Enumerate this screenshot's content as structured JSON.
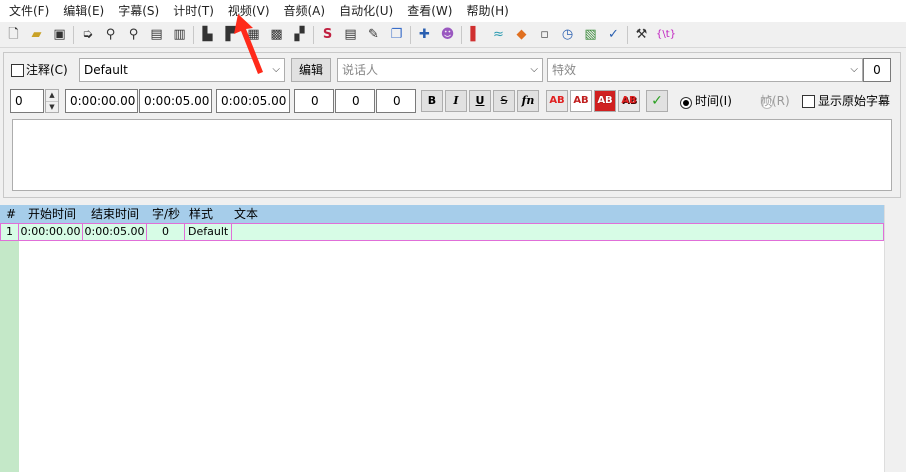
{
  "menu": [
    "文件(F)",
    "编辑(E)",
    "字幕(S)",
    "计时(T)",
    "视频(V)",
    "音频(A)",
    "自动化(U)",
    "查看(W)",
    "帮助(H)"
  ],
  "toolbar": {
    "groups": [
      [
        "new-file-icon",
        "open-folder-icon",
        "save-icon"
      ],
      [
        "jump-icon",
        "zoom-in-icon",
        "zoom-out-icon",
        "snapshot-icon",
        "snapshot-copy-icon"
      ],
      [
        "video-jump-icon",
        "video-zoom-icon",
        "keyframe-icon",
        "video-frame-icon",
        "subtitle-frame-icon"
      ],
      [
        "styles-manager-icon",
        "properties-icon",
        "attachments-icon",
        "fonts-collector-icon"
      ],
      [
        "automation-icon",
        "mascot-icon"
      ],
      [
        "timing-shift-icon",
        "resample-icon",
        "kanji-timer-icon",
        "translation-icon",
        "timer-icon",
        "spellcheck-icon",
        "assistant-check-icon"
      ],
      [
        "options-icon",
        "tag-toggle-icon"
      ]
    ],
    "tag_toggle_text": "{\\t}"
  },
  "editor": {
    "comment_label": "注释(C)",
    "style_value": "Default",
    "edit_button": "编辑",
    "actor_placeholder": "说话人",
    "effect_placeholder": "特效",
    "layer_right_value": "0",
    "layer_value": "0",
    "start_time": "0:00:00.00",
    "end_time": "0:00:05.00",
    "duration": "0:00:05.00",
    "margin_left": "0",
    "margin_right": "0",
    "margin_vertical": "0",
    "bold_label": "B",
    "italic_label": "I",
    "underline_label": "U",
    "strike_label": "S",
    "font_label": "fn",
    "color_labels": [
      "AB",
      "AB",
      "AB",
      "AB"
    ],
    "commit_label": "✓",
    "time_radio_label": "时间(I)",
    "frame_radio_label": "帧(R)",
    "show_original_label": "显示原始字幕",
    "text": ""
  },
  "grid": {
    "headers": [
      "#",
      "开始时间",
      "结束时间",
      "字/秒",
      "样式",
      "文本"
    ],
    "rows": [
      {
        "num": "1",
        "start": "0:00:00.00",
        "end": "0:00:05.00",
        "cps": "0",
        "style": "Default",
        "text": ""
      }
    ]
  },
  "colors": {
    "grid_header": "#a6cdea",
    "selected_row": "#d7fce6",
    "row_border": "#e06fd8",
    "left_strip": "#c4e8c8",
    "annotation_arrow": "#ff2a1a"
  }
}
